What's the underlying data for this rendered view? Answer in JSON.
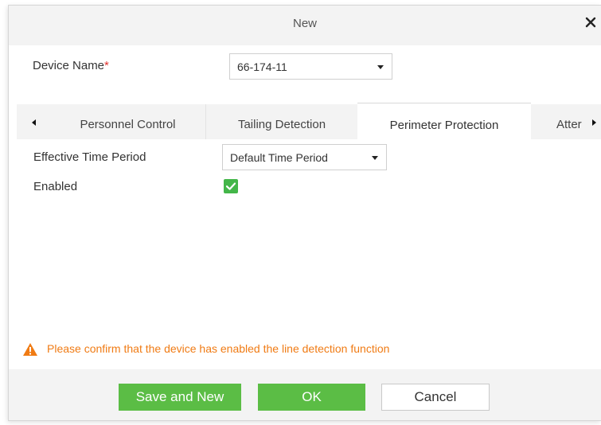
{
  "dialog": {
    "title": "New",
    "close_label": "×"
  },
  "device": {
    "label": "Device Name",
    "required_mark": "*",
    "selected": "66-174-11"
  },
  "tabs": [
    {
      "label": "Personnel Control",
      "active": false
    },
    {
      "label": "Tailing Detection",
      "active": false
    },
    {
      "label": "Perimeter Protection",
      "active": true
    },
    {
      "label": "Atter",
      "active": false
    }
  ],
  "form": {
    "time_period_label": "Effective Time Period",
    "time_period_value": "Default Time Period",
    "enabled_label": "Enabled",
    "enabled_checked": true
  },
  "warning": {
    "message": "Please confirm that the device has enabled the line detection function",
    "color": "#f07b14"
  },
  "buttons": {
    "save_and_new": "Save and New",
    "ok": "OK",
    "cancel": "Cancel"
  },
  "colors": {
    "accent_green": "#5bbd45",
    "required_red": "#e1332f",
    "header_bg": "#f3f3f3"
  }
}
